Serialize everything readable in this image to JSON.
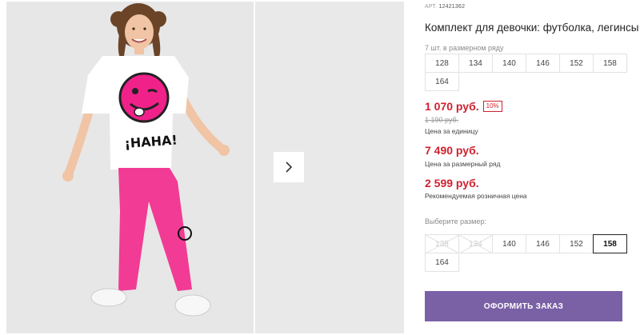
{
  "product": {
    "art_label": "АРТ.",
    "art_number": "12421362",
    "title": "Комплект для девочки: футболка, легинсы",
    "row_count_text": "7 шт. в размерном ряду",
    "row_sizes": [
      "128",
      "134",
      "140",
      "146",
      "152",
      "158",
      "164"
    ]
  },
  "pricing": {
    "unit_price": "1 070 руб.",
    "discount_badge": "10%",
    "old_price": "1 190 руб.",
    "unit_price_caption": "Цена за единицу",
    "row_price": "7 490 руб.",
    "row_price_caption": "Цена за размерный ряд",
    "retail_price": "2 599 руб.",
    "retail_price_caption": "Рекомендуемая розничная цена"
  },
  "size_picker": {
    "label": "Выберите размер:",
    "options": [
      {
        "size": "128",
        "available": false,
        "selected": false
      },
      {
        "size": "134",
        "available": false,
        "selected": false
      },
      {
        "size": "140",
        "available": true,
        "selected": false
      },
      {
        "size": "146",
        "available": true,
        "selected": false
      },
      {
        "size": "152",
        "available": true,
        "selected": false
      },
      {
        "size": "158",
        "available": true,
        "selected": true
      },
      {
        "size": "164",
        "available": true,
        "selected": false
      }
    ]
  },
  "actions": {
    "order_label": "ОФОРМИТЬ ЗАКАЗ"
  },
  "gallery": {
    "shirt_print_text": "¡HAHA!",
    "icons": [
      "chevron-right-icon"
    ]
  },
  "colors": {
    "accent_price": "#d0222f",
    "order_button": "#7a61a6",
    "selected_border": "#222222"
  }
}
